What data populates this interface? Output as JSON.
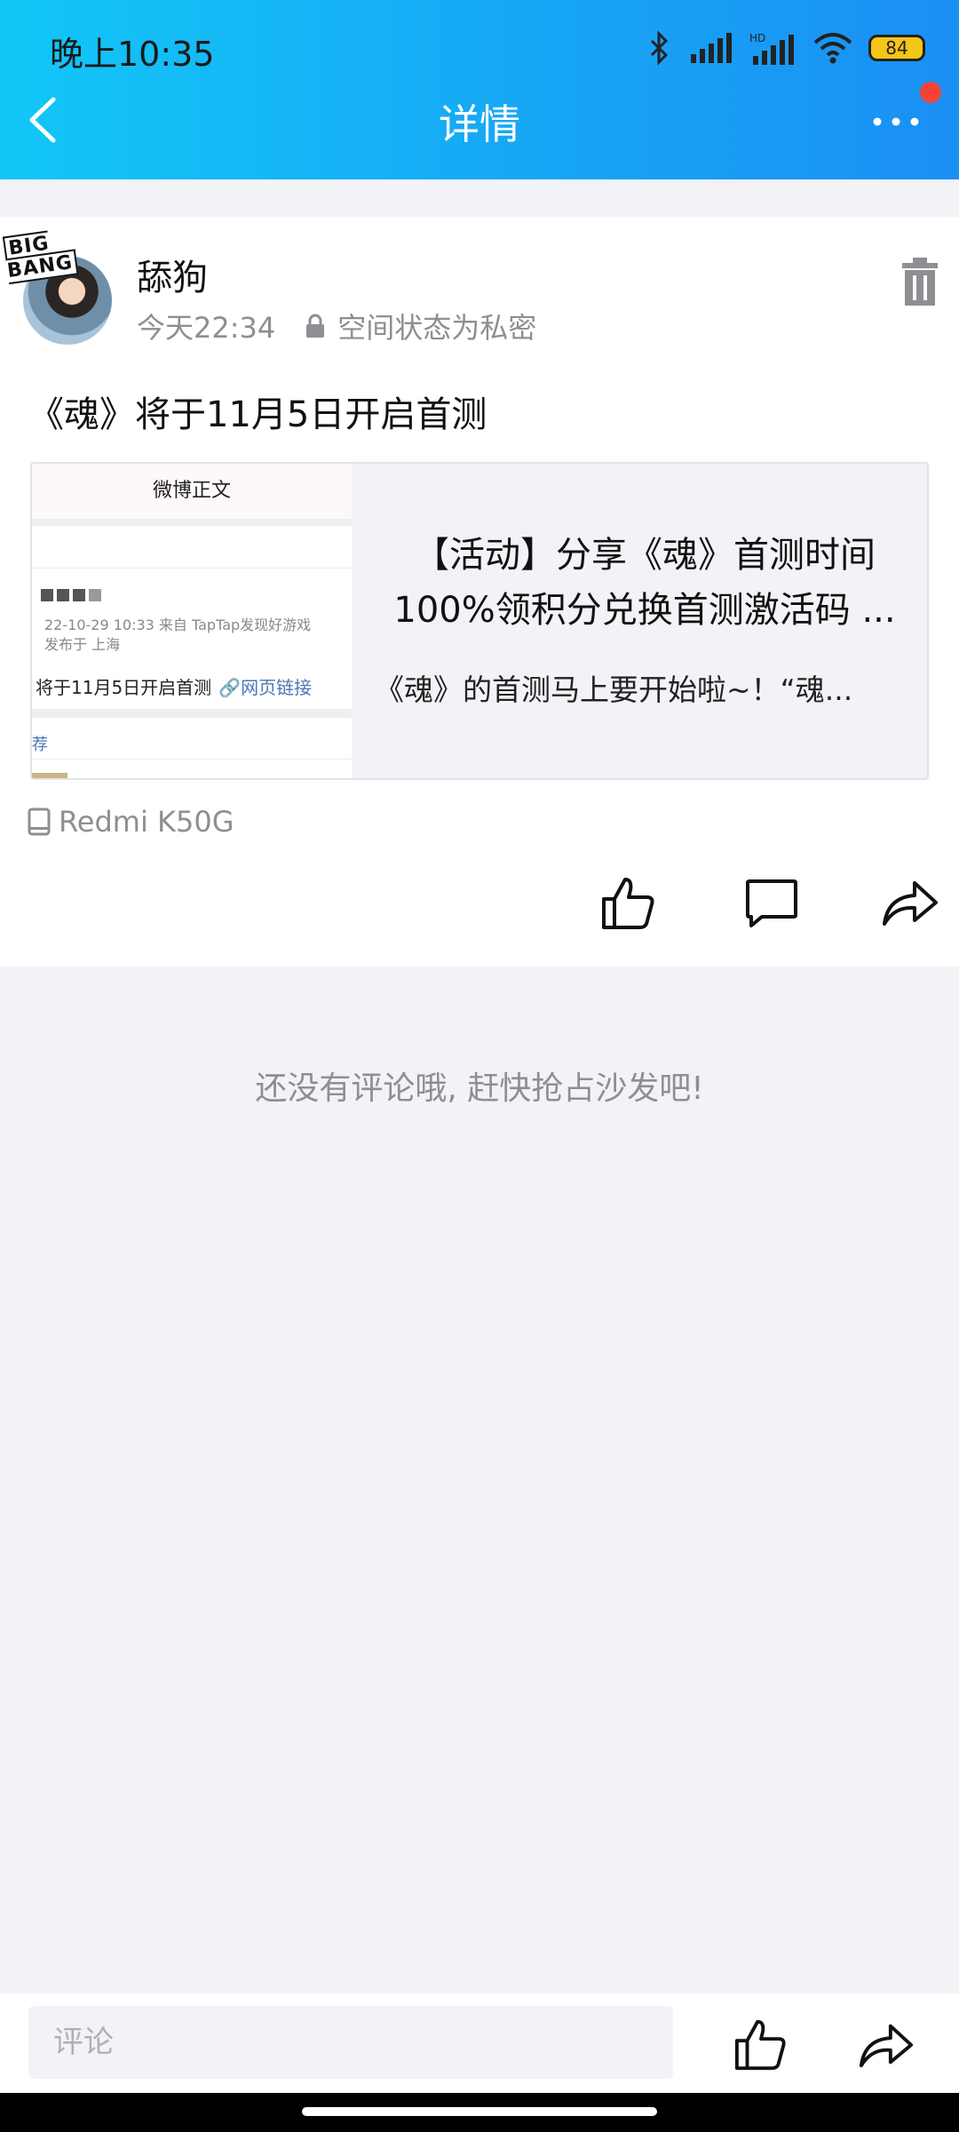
{
  "status_bar": {
    "time": "晚上10:35",
    "battery": "84",
    "icons": [
      "bluetooth-icon",
      "signal-icon",
      "hd-signal-icon",
      "wifi-icon",
      "battery-icon"
    ]
  },
  "header": {
    "title": "详情",
    "colors": {
      "gradient_start": "#12c7f7",
      "gradient_end": "#1a8ff4",
      "badge": "#f44336"
    }
  },
  "post": {
    "avatar_badge": "BIG BANG",
    "user_name": "舔狗",
    "time": "今天22:34",
    "privacy": "空间状态为私密",
    "text": "《魂》将于11月5日开启首测",
    "link_card": {
      "thumb_header": "微博正文",
      "thumb_date": "22-10-29 10:33  来自 TapTap发现好游戏",
      "thumb_location": "发布于 上海",
      "thumb_body": "将于11月5日开启首测",
      "thumb_link": "网页链接",
      "thumb_tag": "荐",
      "title_line1": "【活动】分享《魂》首测时间",
      "title_line2": "100%领积分兑换首测激活码 ...",
      "description": "《魂》的首测马上要开始啦~！“魂..."
    },
    "device": "Redmi K50G"
  },
  "comments": {
    "empty_tip": "还没有评论哦, 赶快抢占沙发吧!"
  },
  "bottom_bar": {
    "comment_placeholder": "评论"
  }
}
